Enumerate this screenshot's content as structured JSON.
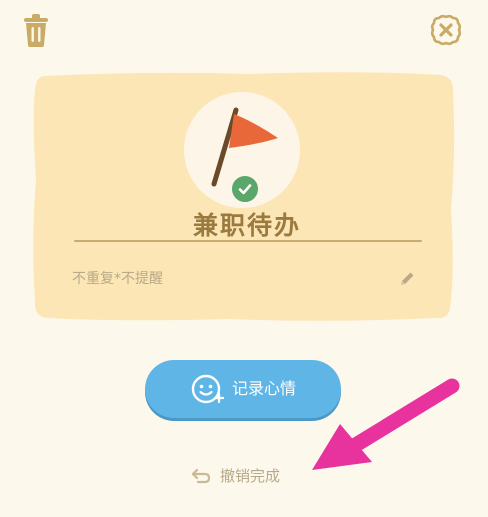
{
  "header": {
    "delete_icon": "trash-icon",
    "close_icon": "close-circle-icon"
  },
  "task": {
    "icon": "flag-icon",
    "status_icon": "check-icon",
    "title": "兼职待办",
    "repeat_reminder": "不重复*不提醒",
    "edit_icon": "pencil-icon"
  },
  "actions": {
    "mood_label": "记录心情",
    "mood_icon": "smiley-icon",
    "undo_label": "撤销完成",
    "undo_icon": "undo-arrow-icon"
  },
  "annotation": {
    "arrow_color": "#e8339e"
  },
  "colors": {
    "background": "#fdf8ec",
    "card": "#fce6b6",
    "title": "#9a7a3e",
    "button": "#5fb6e6",
    "check": "#5aa76b",
    "flag": "#e9683a"
  }
}
